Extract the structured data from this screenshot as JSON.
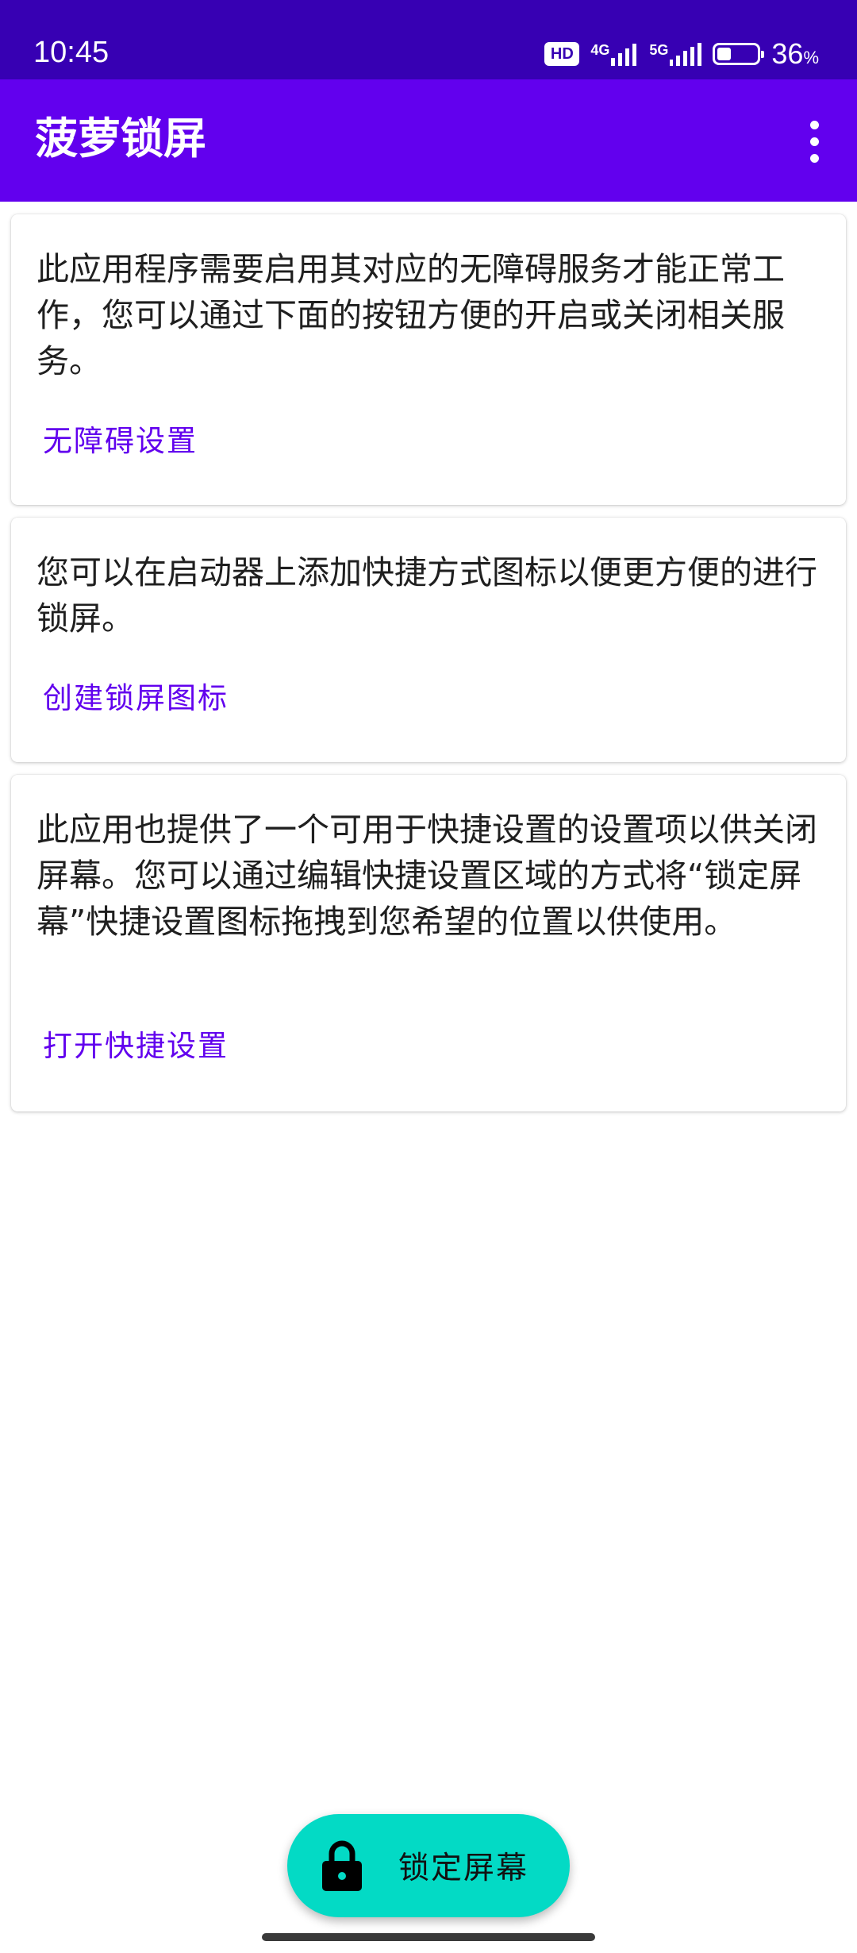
{
  "status_bar": {
    "time": "10:45",
    "hd_badge": "HD",
    "network_1": "4G",
    "network_2": "5G",
    "battery_percent": "36",
    "battery_unit": "%",
    "battery_level": 0.36
  },
  "app_bar": {
    "title": "菠萝锁屏",
    "overflow_icon": "more-vert-icon"
  },
  "cards": [
    {
      "text": "此应用程序需要启用其对应的无障碍服务才能正常工作，您可以通过下面的按钮方便的开启或关闭相关服务。",
      "action": "无障碍设置"
    },
    {
      "text": "您可以在启动器上添加快捷方式图标以便更方便的进行锁屏。",
      "action": "创建锁屏图标"
    },
    {
      "text": "此应用也提供了一个可用于快捷设置的设置项以供关闭屏幕。您可以通过编辑快捷设置区域的方式将“锁定屏幕”快捷设置图标拖拽到您希望的位置以供使用。",
      "action": "打开快捷设置"
    }
  ],
  "fab": {
    "icon": "lock-icon",
    "label": "锁定屏幕"
  },
  "colors": {
    "status_bar": "#3700b3",
    "app_bar": "#6200ee",
    "accent_text": "#6200ee",
    "fab": "#03dac5"
  }
}
